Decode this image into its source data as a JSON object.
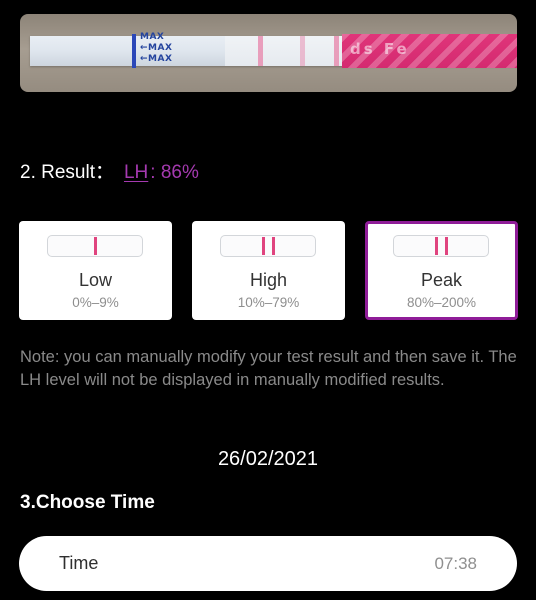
{
  "photo": {
    "strip_markings": [
      "MAX",
      "←MAX",
      "←MAX"
    ],
    "handle_text": "ds Fe",
    "colors": {
      "strip_blue": "#2b47b8",
      "test_line": "#e88fb2",
      "handle_pink": "#d42a70"
    }
  },
  "result": {
    "label": "2. Result：",
    "lh_link": "LH",
    "value": ": 86%",
    "accent_color": "#a53ab0"
  },
  "options": [
    {
      "title": "Low",
      "range": "0%–9%",
      "lines": 1,
      "selected": false
    },
    {
      "title": "High",
      "range": "10%–79%",
      "lines": 2,
      "selected": false
    },
    {
      "title": "Peak",
      "range": "80%–200%",
      "lines": 2,
      "selected": true
    }
  ],
  "note": "Note: you can manually modify your test result and then save it. The LH level will not be displayed in manually modified results.",
  "date": "26/02/2021",
  "choose_time": {
    "title": "3.Choose Time",
    "field_label": "Time",
    "field_value": "07:38"
  },
  "colors": {
    "background": "#000000",
    "selected_border": "#8f1d98",
    "indicator_line": "#e0447f"
  }
}
